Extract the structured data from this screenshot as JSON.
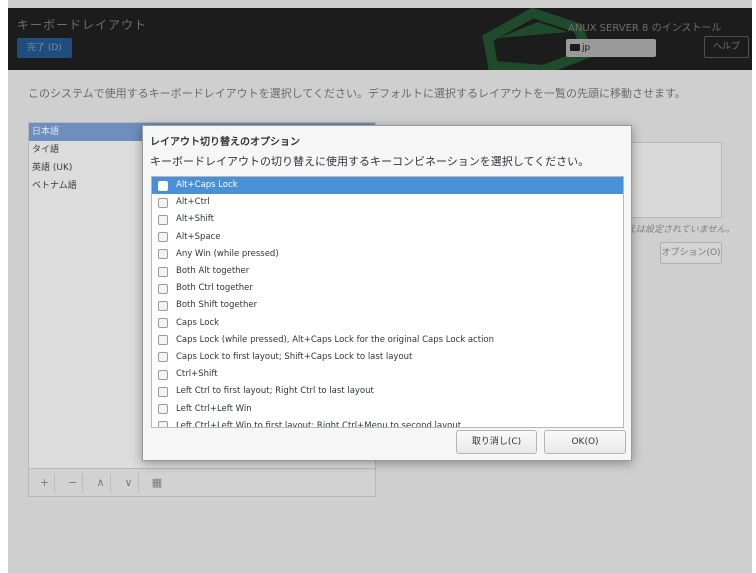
{
  "header": {
    "title": "キーボードレイアウト",
    "done_label": "完了 (D)",
    "install_title": "ANUX SERVER 8 のインストール",
    "keyboard_indicator": "jp",
    "help_label": "ヘルプ"
  },
  "instruction": "このシステムで使用するキーボードレイアウトを選択してください。デフォルトに選択するレイアウトを一覧の先頭に移動させます。",
  "layouts": [
    "日本語",
    "タイ語",
    "英語 (UK)",
    "ベトナム語"
  ],
  "side_note": "えは設定されていません。",
  "options_button": "オプション(O)",
  "toolbar": {
    "add": "+",
    "remove": "−",
    "up": "∧",
    "down": "∨",
    "preview": "▦"
  },
  "dialog": {
    "title": "レイアウト切り替えのオプション",
    "subtitle": "キーボードレイアウトの切り替えに使用するキーコンビネーションを選択してください。",
    "options": [
      "Alt+Caps Lock",
      "Alt+Ctrl",
      "Alt+Shift",
      "Alt+Space",
      "Any Win (while pressed)",
      "Both Alt together",
      "Both Ctrl together",
      "Both Shift together",
      "Caps Lock",
      "Caps Lock (while pressed), Alt+Caps Lock for the original Caps Lock action",
      "Caps Lock to first layout; Shift+Caps Lock to last layout",
      "Ctrl+Shift",
      "Left Ctrl to first layout; Right Ctrl to last layout",
      "Left Ctrl+Left Win",
      "Left Ctrl+Left Win to first layout; Right Ctrl+Menu to second layout"
    ],
    "cancel_label": "取り消し(C)",
    "ok_label": "OK(O)"
  },
  "colors": {
    "selection": "#4a90d9",
    "header_bg": "#1c1c1c",
    "done_btn": "#1f4e7e"
  }
}
